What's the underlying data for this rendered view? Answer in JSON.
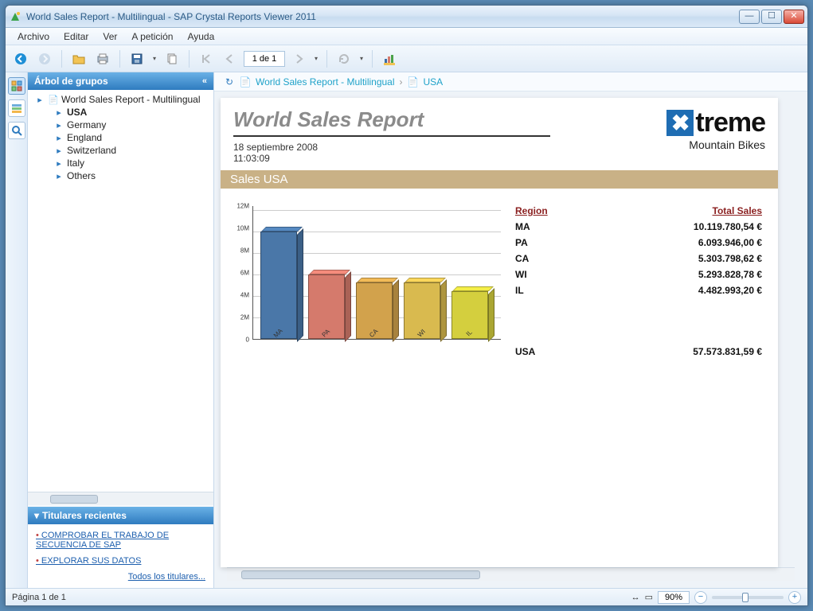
{
  "window": {
    "title": "World Sales Report - Multilingual - SAP Crystal Reports Viewer 2011"
  },
  "menu": {
    "archivo": "Archivo",
    "editar": "Editar",
    "ver": "Ver",
    "apeticion": "A petición",
    "ayuda": "Ayuda"
  },
  "toolbar": {
    "page_indicator": "1 de 1"
  },
  "sidebar": {
    "group_tree_title": "Árbol de grupos",
    "root": "World Sales Report - Multilingual",
    "nodes": [
      "USA",
      "Germany",
      "England",
      "Switzerland",
      "Italy",
      "Others"
    ],
    "selected": "USA",
    "headlines_title": "Titulares recientes",
    "headlines": [
      "COMPROBAR EL TRABAJO DE SECUENCIA DE SAP",
      "EXPLORAR SUS DATOS"
    ],
    "all_headlines": "Todos los titulares..."
  },
  "breadcrumb": {
    "root": "World Sales Report - Multilingual",
    "leaf": "USA"
  },
  "report": {
    "title": "World Sales Report",
    "date": "18 septiembre 2008",
    "time": "11:03:09",
    "logo_main": "treme",
    "logo_sub": "Mountain Bikes",
    "band": "Sales USA",
    "col_region": "Region",
    "col_total": "Total Sales",
    "rows": [
      {
        "region": "MA",
        "sales": "10.119.780,54 €"
      },
      {
        "region": "PA",
        "sales": "6.093.946,00 €"
      },
      {
        "region": "CA",
        "sales": "5.303.798,62 €"
      },
      {
        "region": "WI",
        "sales": "5.293.828,78 €"
      },
      {
        "region": "IL",
        "sales": "4.482.993,20 €"
      }
    ],
    "total_region": "USA",
    "total_sales": "57.573.831,59 €"
  },
  "chart_data": {
    "type": "bar",
    "categories": [
      "MA",
      "PA",
      "CA",
      "WI",
      "IL"
    ],
    "values": [
      10.1,
      6.1,
      5.3,
      5.3,
      4.5
    ],
    "colors": [
      "#4a77a8",
      "#d57a6c",
      "#d2a24c",
      "#d9ba4f",
      "#d4cf3e"
    ],
    "ylabel_ticks": [
      "0",
      "2M",
      "4M",
      "6M",
      "8M",
      "10M",
      "12M"
    ],
    "ylim": [
      0,
      12
    ]
  },
  "status": {
    "page": "Página 1 de 1",
    "zoom": "90%"
  }
}
